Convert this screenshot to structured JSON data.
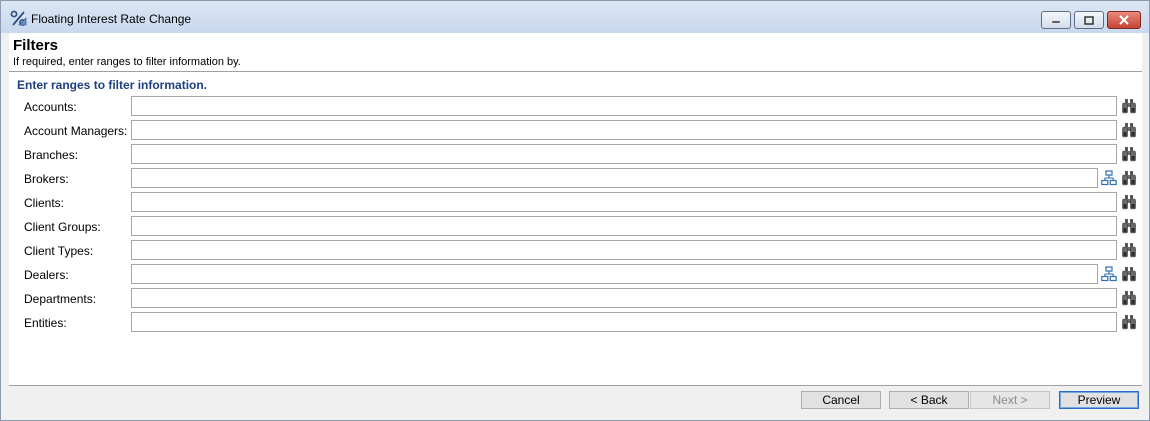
{
  "window": {
    "title": "Floating Interest Rate Change"
  },
  "header": {
    "title": "Filters",
    "subtitle": "If required, enter ranges to filter information by."
  },
  "group": {
    "title": "Enter ranges to filter information."
  },
  "fields": [
    {
      "label": "Accounts:",
      "value": "",
      "tree": false
    },
    {
      "label": "Account Managers:",
      "value": "",
      "tree": false
    },
    {
      "label": "Branches:",
      "value": "",
      "tree": false
    },
    {
      "label": "Brokers:",
      "value": "",
      "tree": true
    },
    {
      "label": "Clients:",
      "value": "",
      "tree": false
    },
    {
      "label": "Client Groups:",
      "value": "",
      "tree": false
    },
    {
      "label": "Client Types:",
      "value": "",
      "tree": false
    },
    {
      "label": "Dealers:",
      "value": "",
      "tree": true
    },
    {
      "label": "Departments:",
      "value": "",
      "tree": false
    },
    {
      "label": "Entities:",
      "value": "",
      "tree": false
    }
  ],
  "buttons": {
    "cancel": "Cancel",
    "back": "< Back",
    "next": "Next >",
    "preview": "Preview"
  },
  "icons": {
    "lookup": "binoculars-icon",
    "hierarchy": "hierarchy-tree-icon",
    "app": "percent-app-icon"
  },
  "colors": {
    "group_title": "#1e3f80",
    "tree_icon": "#2f6fb5"
  }
}
